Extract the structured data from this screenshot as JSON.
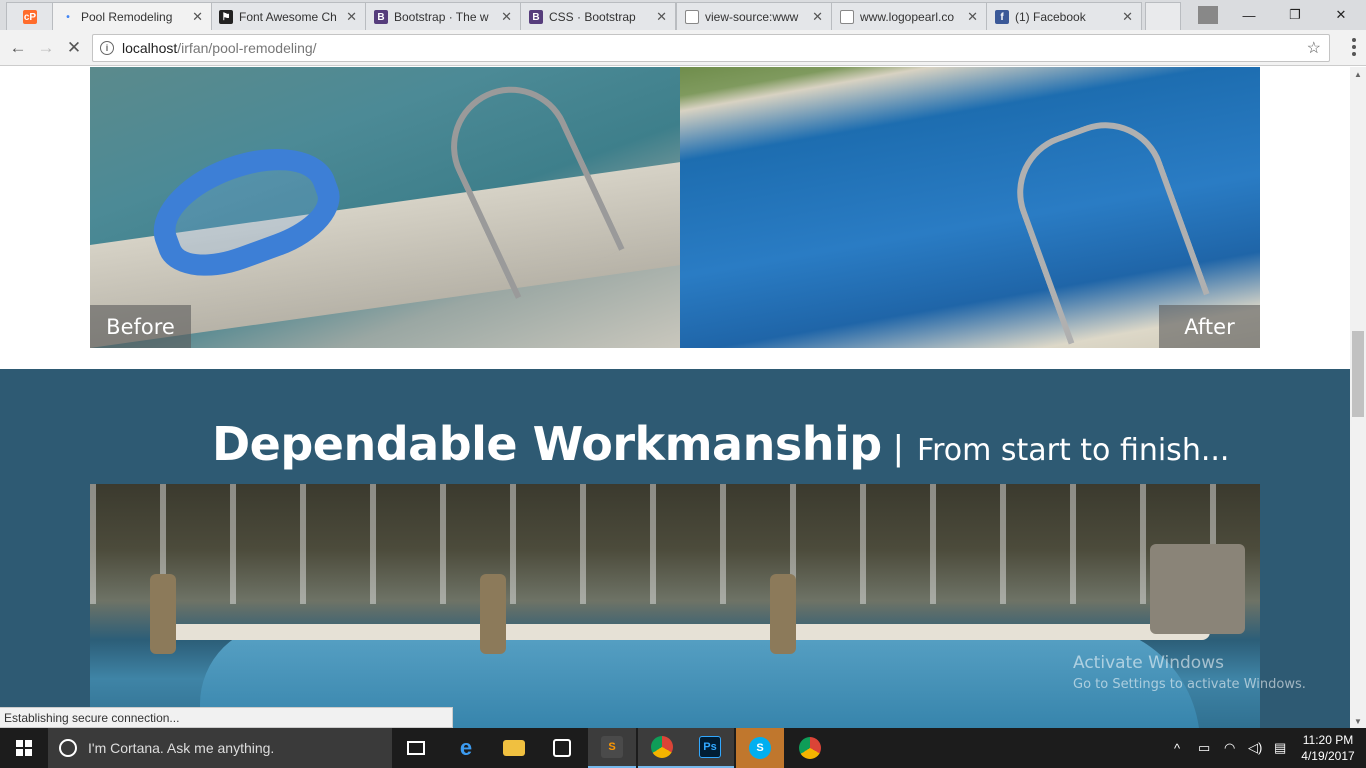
{
  "browser": {
    "tabs": [
      {
        "label": "",
        "icon": "cpanel-icon",
        "color": "#ff6c2c"
      },
      {
        "label": "Pool Remodeling",
        "icon": "loading-icon",
        "color": "#4285f4"
      },
      {
        "label": "Font Awesome Ch",
        "icon": "flag-icon",
        "color": "#222222"
      },
      {
        "label": "Bootstrap · The w",
        "icon": "bootstrap-icon",
        "color": "#563d7c"
      },
      {
        "label": "CSS · Bootstrap",
        "icon": "bootstrap-icon",
        "color": "#563d7c"
      },
      {
        "label": "view-source:www",
        "icon": "page-icon",
        "color": "#888888"
      },
      {
        "label": "www.logopearl.co",
        "icon": "page-icon",
        "color": "#888888"
      },
      {
        "label": "(1) Facebook",
        "icon": "facebook-icon",
        "color": "#3b5998"
      }
    ],
    "url_host": "localhost",
    "url_path": "/irfan/pool-remodeling/",
    "status_text": "Establishing secure connection..."
  },
  "page": {
    "before_label": "Before",
    "after_label": "After",
    "section_heading": "Dependable Workmanship",
    "section_separator": "|",
    "section_subheading": "From start to finish...",
    "section_bg": "#2e5a73"
  },
  "watermark": {
    "title": "Activate Windows",
    "subtitle": "Go to Settings to activate Windows."
  },
  "taskbar": {
    "cortana_text": "I'm Cortana. Ask me anything.",
    "time": "11:20 PM",
    "date": "4/19/2017"
  }
}
